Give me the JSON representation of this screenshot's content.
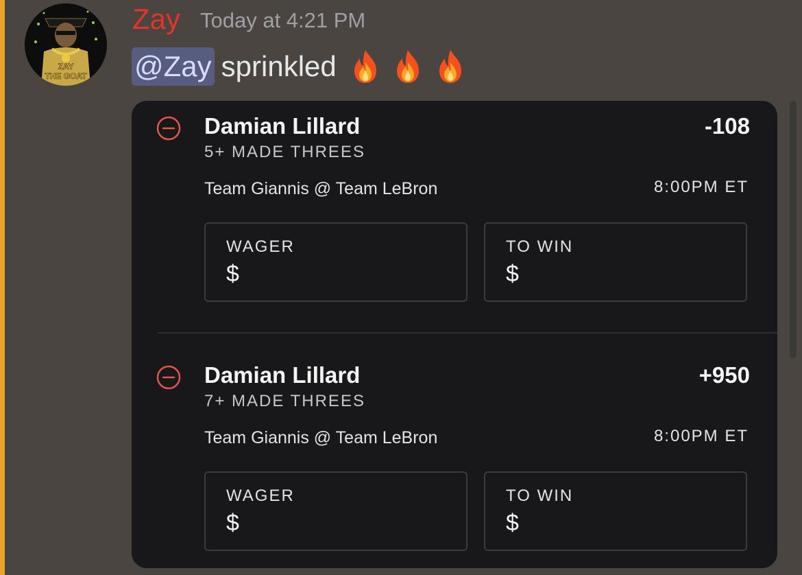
{
  "message": {
    "username": "Zay",
    "timestamp": "Today at 4:21 PM",
    "mention": "@Zay",
    "text": "sprinkled",
    "emojis": [
      "fire-emoji",
      "fire-emoji",
      "fire-emoji"
    ],
    "avatar_text": [
      "ZAY",
      "THE GOAT"
    ]
  },
  "colors": {
    "username": "#e0352b",
    "accent_bar": "#e8a42b",
    "mention_bg": "#585c7e",
    "remove_icon": "#e0574a"
  },
  "bets": [
    {
      "player": "Damian Lillard",
      "market": "5+ MADE THREES",
      "odds": "-108",
      "matchup": "Team Giannis @ Team LeBron",
      "time": "8:00PM ET",
      "wager_label": "WAGER",
      "wager_value": "$",
      "towin_label": "TO WIN",
      "towin_value": "$"
    },
    {
      "player": "Damian Lillard",
      "market": "7+ MADE THREES",
      "odds": "+950",
      "matchup": "Team Giannis @ Team LeBron",
      "time": "8:00PM ET",
      "wager_label": "WAGER",
      "wager_value": "$",
      "towin_label": "TO WIN",
      "towin_value": "$"
    }
  ]
}
